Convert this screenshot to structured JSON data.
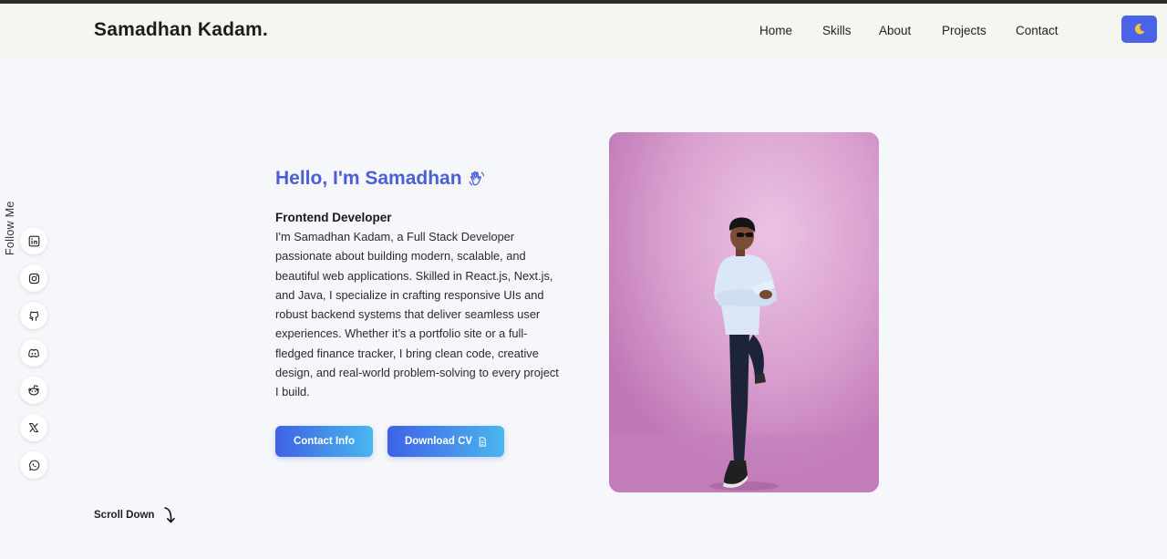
{
  "header": {
    "logo": "Samadhan Kadam.",
    "nav": [
      "Home",
      "Skills",
      "About",
      "Projects",
      "Contact"
    ],
    "theme_toggle_icon": "moon-icon"
  },
  "sidebar": {
    "follow_label": "Follow Me",
    "socials": [
      "linkedin-icon",
      "instagram-icon",
      "github-icon",
      "discord-icon",
      "reddit-icon",
      "x-icon",
      "whatsapp-icon"
    ]
  },
  "hero": {
    "greeting": "Hello, I'm Samadhan",
    "greeting_icon": "waving-hand-icon",
    "role": "Frontend Developer",
    "description": "I'm Samadhan Kadam, a Full Stack Developer passionate about building modern, scalable, and beautiful web applications. Skilled in React.js, Next.js, and Java, I specialize in crafting responsive UIs and robust backend systems that deliver seamless user experiences. Whether it’s a portfolio site or a full-fledged finance tracker, I bring clean code, creative design, and real-world problem-solving to every project I build.",
    "contact_button": "Contact Info",
    "cv_button": "Download CV",
    "cv_icon": "document-icon"
  },
  "scroll": {
    "label": "Scroll Down",
    "icon": "curved-arrow-down-icon"
  },
  "colors": {
    "accent": "#4a5fd6",
    "button_start": "#3f61e6",
    "button_end": "#49b7ef",
    "navbar_bg": "#f6f6f0",
    "page_bg": "#f5f7fa",
    "photo_bg": "#d596c9"
  }
}
